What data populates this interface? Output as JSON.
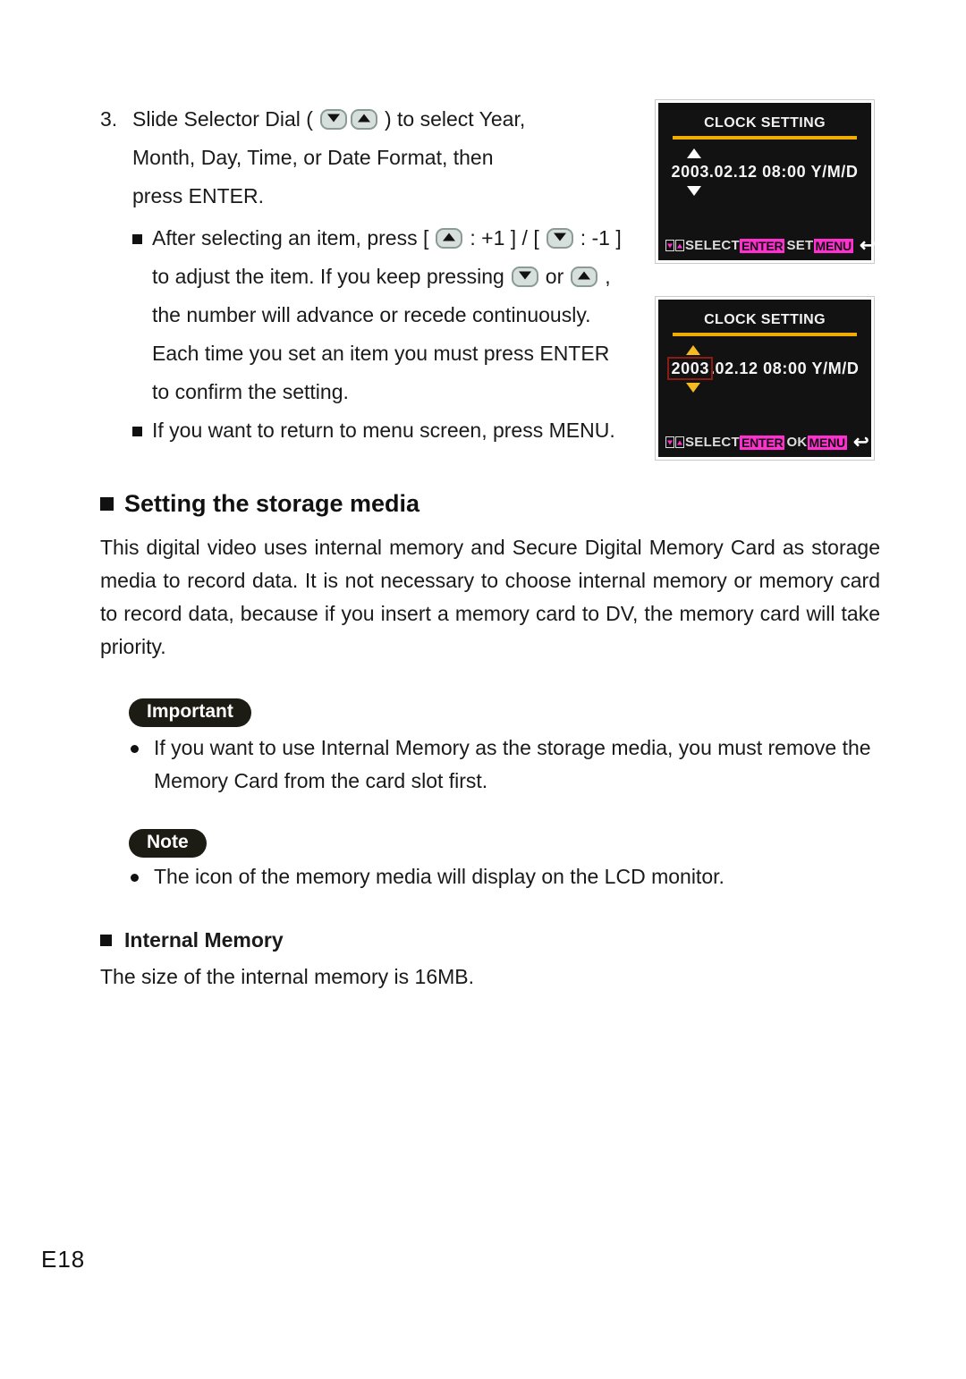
{
  "step": {
    "number": "3.",
    "line1_pre": "Slide Selector Dial (",
    "line1_post": ") to select Year,",
    "line2": "Month, Day, Time, or Date Format, then",
    "line3": "press ENTER.",
    "bullets": [
      {
        "seg1": "After selecting an item, press [",
        "seg2": ": +1 ] / [",
        "seg3": ": -1 ]",
        "seg4": "to adjust the item. If you keep pressing",
        "seg5": "or",
        "seg6": ",",
        "seg7": "the number will advance or recede continuously.",
        "seg8": "Each time you set an item you must press ENTER",
        "seg9": "to confirm the setting."
      },
      {
        "seg1": "If you want to return to menu screen, press MENU."
      }
    ]
  },
  "lcd_screens": [
    {
      "title": "CLOCK SETTING",
      "date_full": "2003.02.12 08:00 Y/M/D",
      "highlight_segment": "",
      "date_rest": "2003.02.12 08:00 Y/M/D",
      "arrow_color": "#ffffff",
      "select_label": "SELECT",
      "enter_tag": "ENTER",
      "enter_action": "SET",
      "menu_tag": "MENU",
      "return_arrow": "↩"
    },
    {
      "title": "CLOCK SETTING",
      "date_full": "2003.02.12 08:00 Y/M/D",
      "highlight_segment": "2003",
      "date_rest": ".02.12 08:00 Y/M/D",
      "arrow_color": "#f5b921",
      "select_label": "SELECT",
      "enter_tag": "ENTER",
      "enter_action": "OK",
      "menu_tag": "MENU",
      "return_arrow": "↩"
    }
  ],
  "section": {
    "heading": "Setting the storage media",
    "paragraph": "This digital video uses internal memory and Secure Digital Memory Card as storage media to record data. It is not necessary to choose internal memory or memory card to record data, because if you insert a memory card to DV, the memory card will take priority."
  },
  "important": {
    "badge": "Important",
    "items": [
      "If you want to use Internal Memory as the storage media, you must remove the Memory Card from the card slot first."
    ]
  },
  "note": {
    "badge": "Note",
    "items": [
      "The icon of the memory media will display on the LCD monitor."
    ]
  },
  "internal_memory": {
    "heading": "Internal Memory",
    "paragraph": "The size of the internal memory is 16MB."
  },
  "footer": {
    "page_label": "E18"
  },
  "colors": {
    "lcd_background": "#121212",
    "lcd_rule": "#f0ad00",
    "highlight_box": "#8a1c12",
    "amber_arrow": "#f5b921",
    "pink_tag": "#ff2fd0",
    "badge_background": "#1c1c14"
  }
}
